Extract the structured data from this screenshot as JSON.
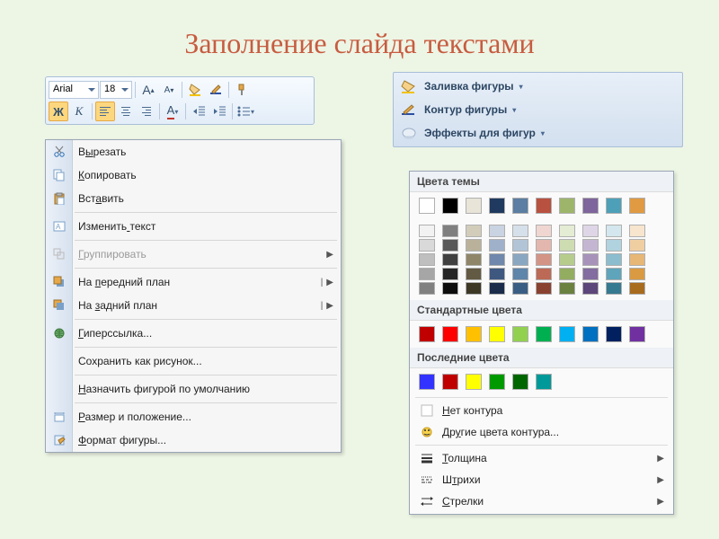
{
  "title": "Заполнение слайда текстами",
  "minibar": {
    "font_name": "Arial",
    "font_size": "18",
    "grow_font": "A",
    "shrink_font": "A",
    "bold": "Ж",
    "italic": "К",
    "font_color_letter": "A"
  },
  "context_menu": {
    "cut": "Вырезать",
    "copy": "Копировать",
    "paste": "Вставить",
    "edit_text": "Изменить текст",
    "group": "Группировать",
    "bring_front": "На передний план",
    "send_back": "На задний план",
    "hyperlink": "Гиперссылка...",
    "save_as_picture": "Сохранить как рисунок...",
    "set_default": "Назначить фигурой по умолчанию",
    "size_position": "Размер и положение...",
    "format_shape": "Формат фигуры...",
    "underline_index": {
      "cut": 1,
      "copy": 0,
      "paste": 3,
      "edit_text": 8,
      "group": 0,
      "bring_front": 3,
      "send_back": 3,
      "hyperlink": 0,
      "set_default": 0,
      "size_position": 0,
      "format_shape": 0
    }
  },
  "shape_tools": {
    "fill": "Заливка фигуры",
    "outline": "Контур фигуры",
    "effects": "Эффекты для фигур"
  },
  "color_panel": {
    "theme_header": "Цвета темы",
    "theme_top": [
      "#ffffff",
      "#000000",
      "#e8e4d8",
      "#203a5f",
      "#5b7ea2",
      "#b85140",
      "#9db56a",
      "#7e659b",
      "#4da0b8",
      "#e09a42"
    ],
    "theme_shades": [
      [
        "#f2f2f2",
        "#7f7f7f",
        "#d2ccba",
        "#c9d3e2",
        "#d6e0ea",
        "#f0d6d0",
        "#e4ecd4",
        "#ded6e6",
        "#d4e7ee",
        "#f7e5cd"
      ],
      [
        "#d9d9d9",
        "#595959",
        "#b9b19a",
        "#9fb1ca",
        "#b2c5d7",
        "#e3b7ad",
        "#cedcb2",
        "#c4b6d2",
        "#b1d2df",
        "#efcfa2"
      ],
      [
        "#bfbfbf",
        "#404040",
        "#8f866a",
        "#6f88ab",
        "#8aa7c2",
        "#d49485",
        "#b6cc8d",
        "#a793ba",
        "#8bbdce",
        "#e6b776"
      ],
      [
        "#a6a6a6",
        "#262626",
        "#625a42",
        "#3e5880",
        "#5e85aa",
        "#bc6a56",
        "#93ad60",
        "#836c9f",
        "#5ea4ba",
        "#d99a42"
      ],
      [
        "#808080",
        "#0d0d0d",
        "#3d3726",
        "#1a2c4a",
        "#3a5e83",
        "#8a4230",
        "#6a8140",
        "#5d4679",
        "#357a90",
        "#a86c1e"
      ]
    ],
    "standard_header": "Стандартные цвета",
    "standard": [
      "#c00000",
      "#ff0000",
      "#ffc000",
      "#ffff00",
      "#92d050",
      "#00b050",
      "#00b0f0",
      "#0070c0",
      "#002060",
      "#7030a0"
    ],
    "recent_header": "Последние цвета",
    "recent": [
      "#3333ff",
      "#c00000",
      "#ffff00",
      "#009900",
      "#006600",
      "#009999"
    ],
    "no_outline": "Нет контура",
    "more_colors": "Другие цвета контура...",
    "weight": "Толщина",
    "dashes": "Штрихи",
    "arrows": "Стрелки",
    "underline_index": {
      "no_outline": 0,
      "more_colors": 2,
      "weight": 0,
      "dashes": 1,
      "arrows": 0
    }
  }
}
